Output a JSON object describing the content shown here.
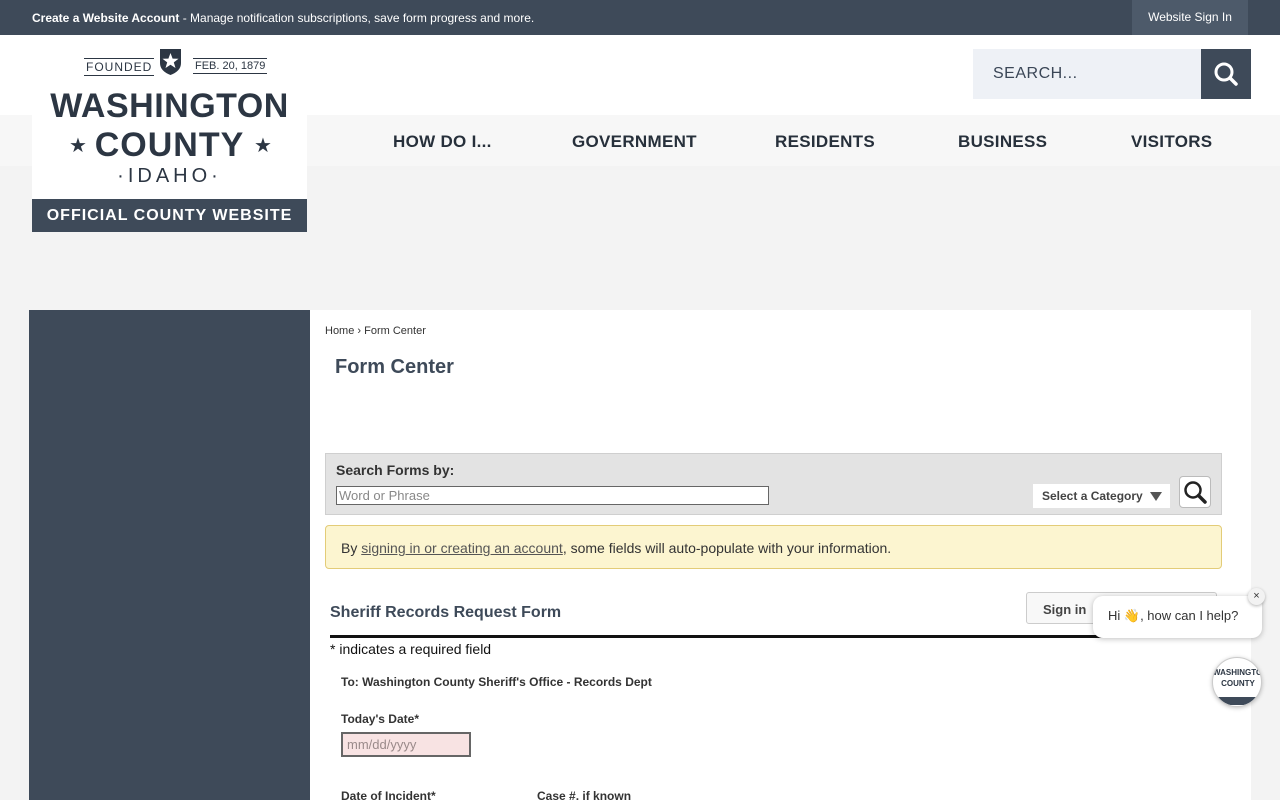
{
  "topbar": {
    "create_label": "Create a Website Account",
    "create_desc": " - Manage notification subscriptions, save form progress and more.",
    "signin_label": "Website Sign In"
  },
  "logo": {
    "founded": "FOUNDED",
    "date": "FEB. 20, 1879",
    "line1": "WASHINGTON",
    "line2": "COUNTY",
    "line3": "·IDAHO·",
    "tagline": "OFFICIAL COUNTY WEBSITE",
    "star": "★"
  },
  "search": {
    "placeholder": "SEARCH...",
    "icon": "search-icon"
  },
  "nav": {
    "items": [
      "HOW DO I...",
      "GOVERNMENT",
      "RESIDENTS",
      "BUSINESS",
      "VISITORS"
    ]
  },
  "breadcrumb": {
    "home": "Home",
    "sep": " › ",
    "current": "Form Center"
  },
  "page_title": "Form Center",
  "search_forms": {
    "label": "Search Forms by:",
    "placeholder": "Word or Phrase",
    "category": "Select a Category",
    "icon": "magnifier-icon"
  },
  "notice": {
    "prefix": "By ",
    "link": "signing in or creating an account",
    "suffix": ", some fields will auto-populate with your information."
  },
  "form": {
    "title": "Sheriff Records Request Form",
    "signin_button": "Sign in",
    "required_note": "* indicates a required field",
    "to_line": "To: Washington County Sheriff's Office - Records Dept",
    "date_label": "Today's Date*",
    "date_placeholder": "mm/dd/yyyy",
    "incident_label": "Date of Incident*",
    "case_label": "Case #, if known"
  },
  "chat": {
    "message": "Hi 👋, how can I help?",
    "close": "×",
    "avatar_line1": "WASHINGTON",
    "avatar_line2": "COUNTY"
  },
  "colors": {
    "brand_dark": "#3e4a59",
    "notice_bg": "#fcf5d0",
    "required_input_bg": "#f8e3e3"
  }
}
